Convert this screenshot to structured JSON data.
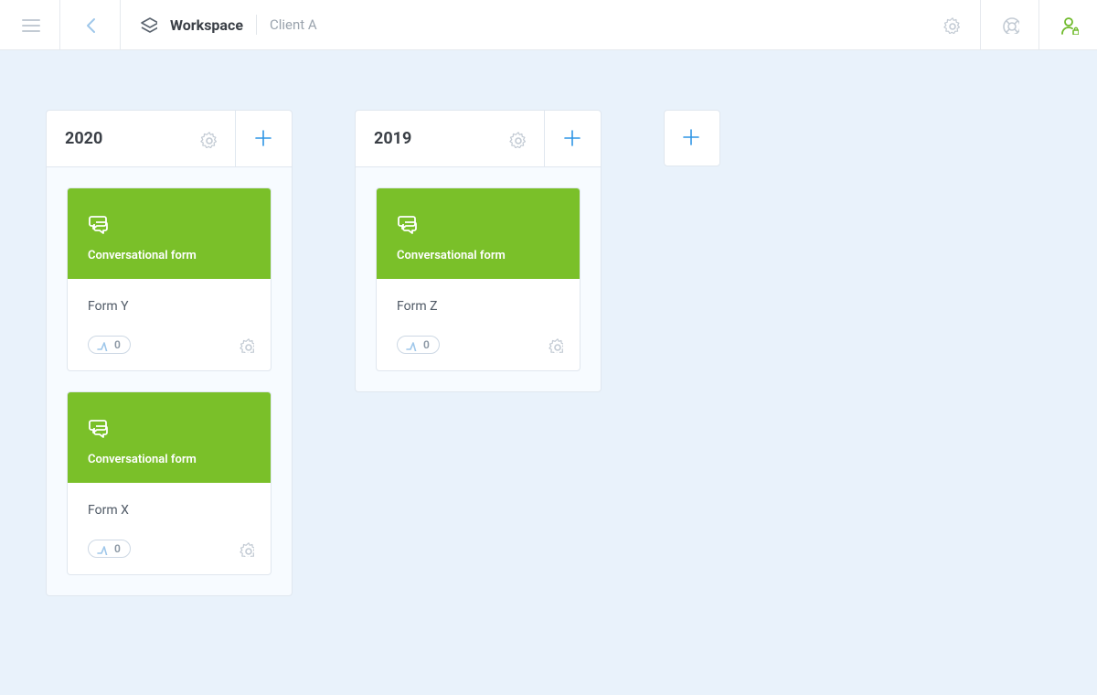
{
  "header": {
    "workspace_label": "Workspace",
    "client_label": "Client A"
  },
  "groups": [
    {
      "title": "2020",
      "cards": [
        {
          "type_label": "Conversational form",
          "name": "Form Y",
          "count": "0"
        },
        {
          "type_label": "Conversational form",
          "name": "Form X",
          "count": "0"
        }
      ]
    },
    {
      "title": "2019",
      "cards": [
        {
          "type_label": "Conversational form",
          "name": "Form Z",
          "count": "0"
        }
      ]
    }
  ]
}
